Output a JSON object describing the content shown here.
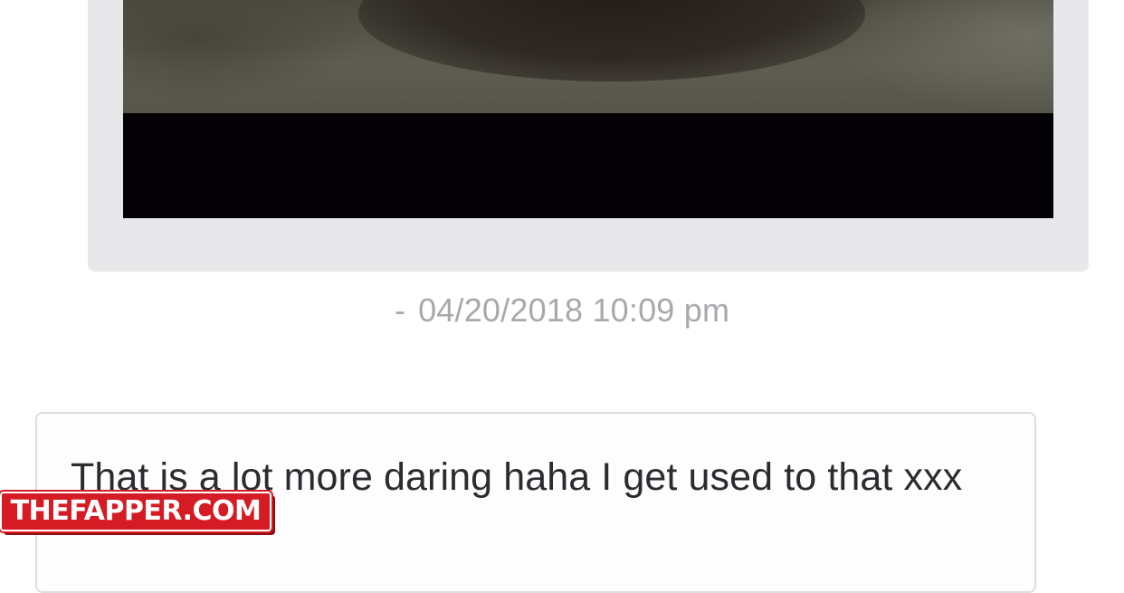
{
  "conversation": {
    "received_message": {
      "attachment": "photo",
      "timestamp_separator": "-",
      "timestamp": "04/20/2018 10:09 pm"
    },
    "sent_message": {
      "text": "That is a lot more daring haha I get used to that xxx"
    }
  },
  "watermark": {
    "text": "THEFAPPER.COM"
  },
  "colors": {
    "received_bubble": "#e8e7e9",
    "sent_bubble_border": "#dedee2",
    "timestamp": "#a7a9ad",
    "watermark_bg": "#d51c24"
  }
}
